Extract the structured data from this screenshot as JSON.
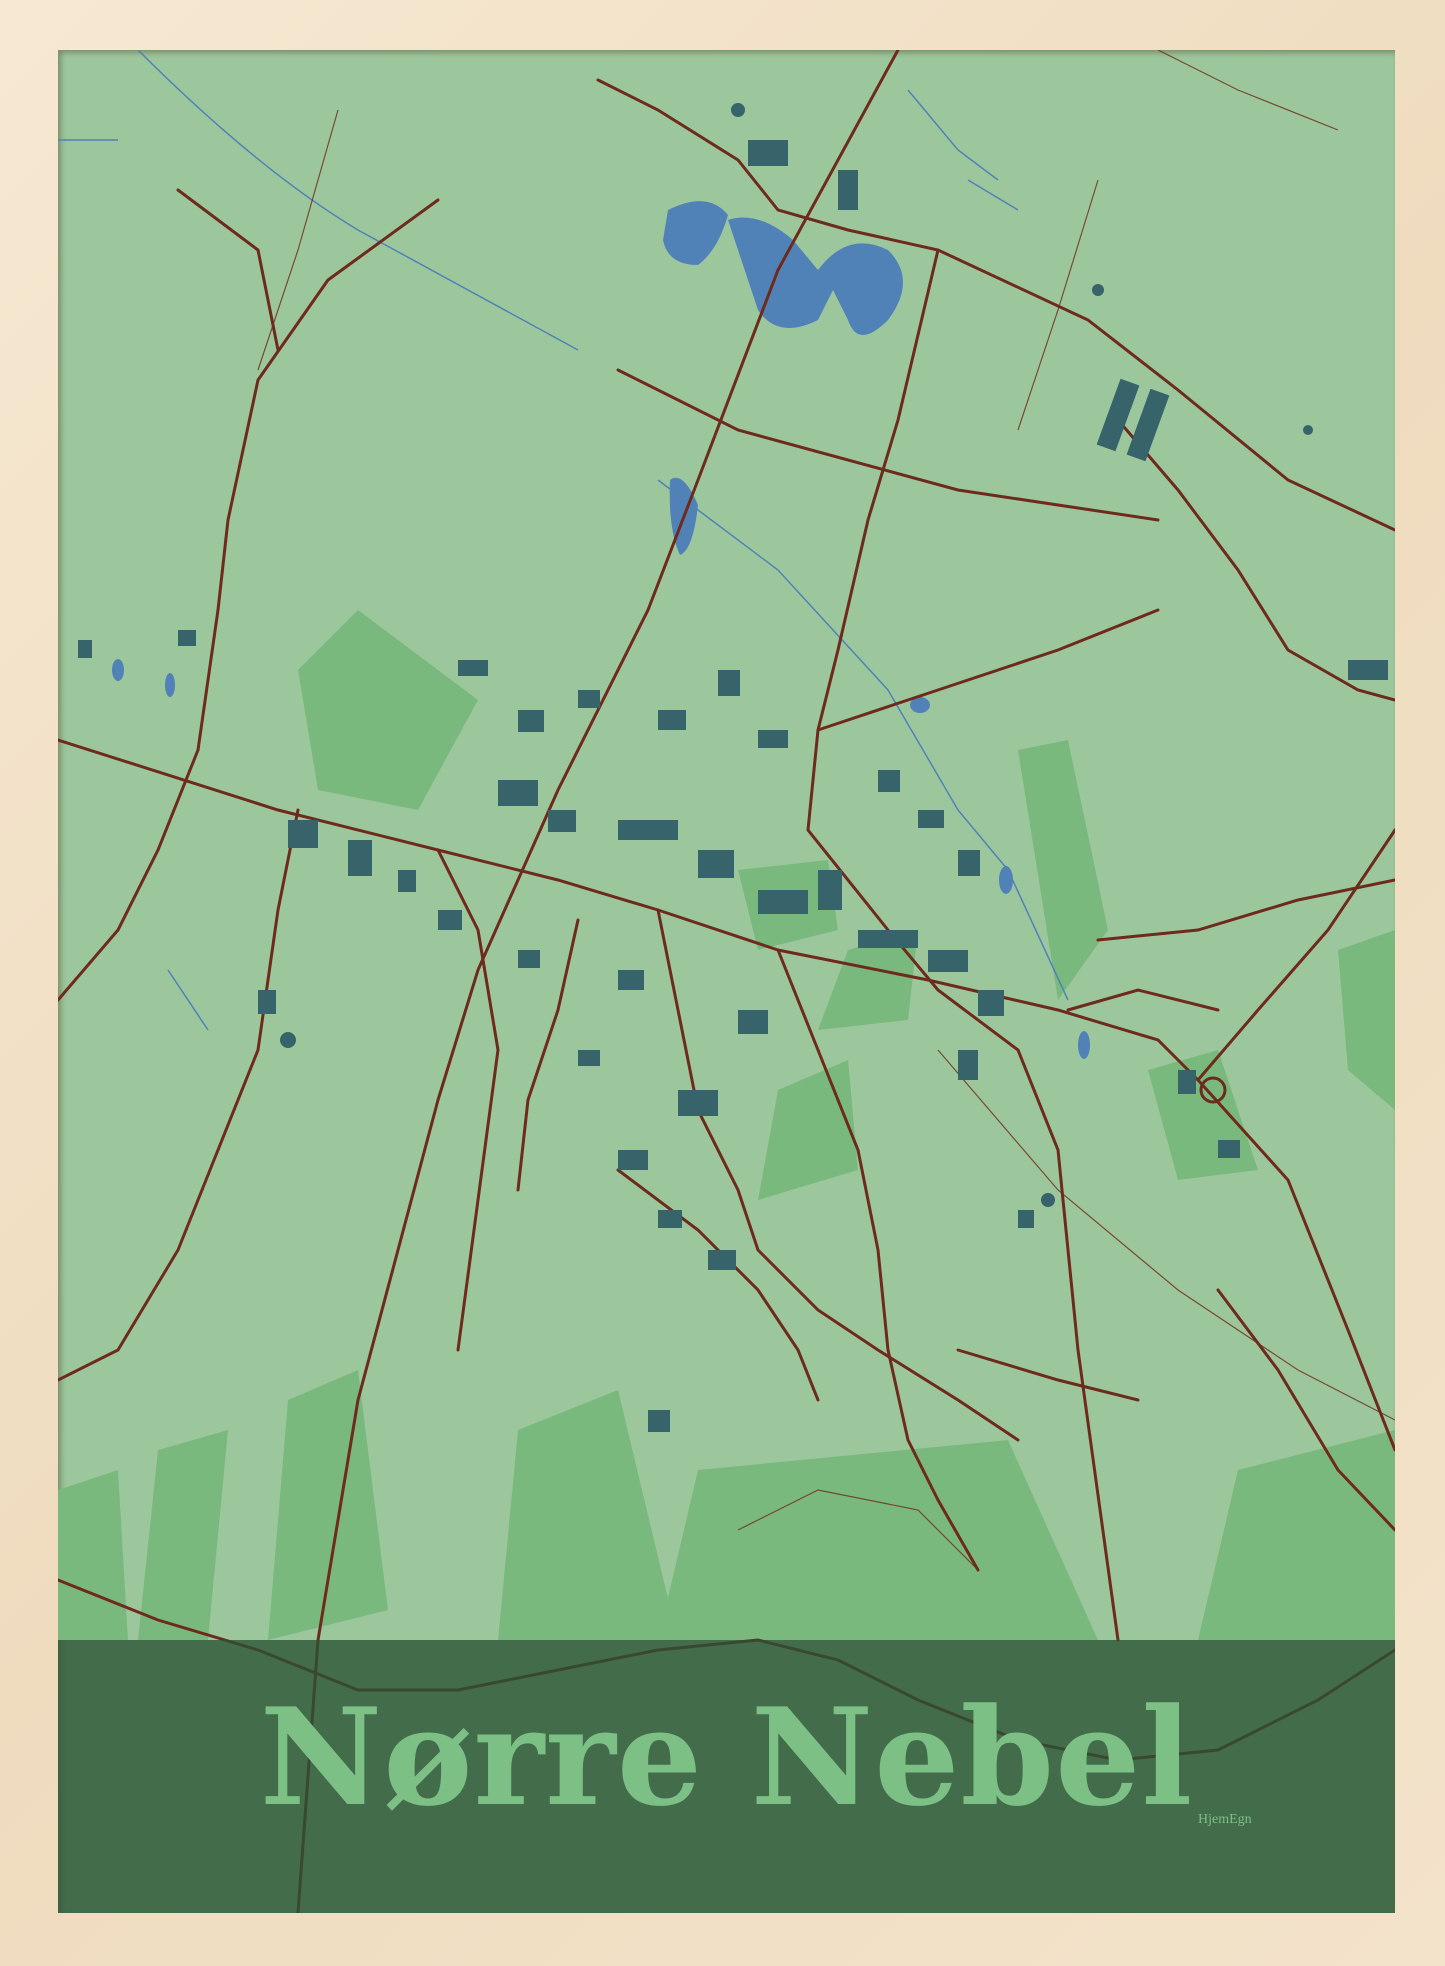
{
  "poster": {
    "title": "Nørre Nebel",
    "brand": "HjemEgn"
  },
  "colors": {
    "frame": "#f2e2c8",
    "land": "#9cc79c",
    "park": "#7ab97e",
    "water": "#5082b8",
    "road": "#6e2a1c",
    "building": "#37636a",
    "title_band": "#2a5234",
    "title_text": "#7dc085"
  }
}
